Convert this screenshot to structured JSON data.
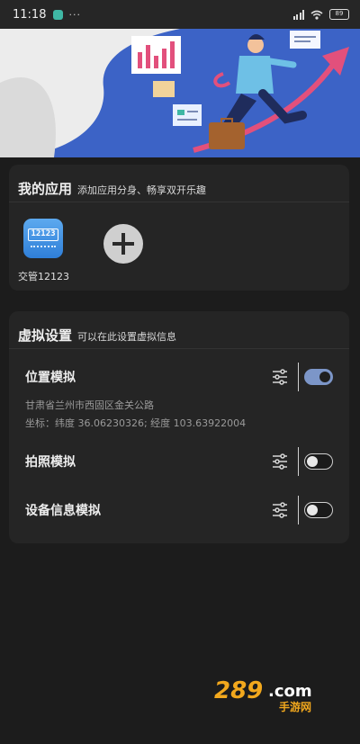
{
  "status_bar": {
    "time": "11:18",
    "dots": "···",
    "battery": "89"
  },
  "apps_card": {
    "title": "我的应用",
    "subtitle": "添加应用分身、畅享双开乐趣",
    "apps": [
      {
        "label": "交管12123",
        "icon_text": "12123",
        "icon": "traffic-app-icon"
      }
    ],
    "add_icon": "plus-icon"
  },
  "virtual_card": {
    "title": "虚拟设置",
    "subtitle": "可以在此设置虚拟信息",
    "rows": [
      {
        "label": "位置模拟",
        "enabled": true,
        "address": "甘肃省兰州市西固区金关公路",
        "coords": "坐标：纬度 36.06230326; 经度 103.63922004"
      },
      {
        "label": "拍照模拟",
        "enabled": false
      },
      {
        "label": "设备信息模拟",
        "enabled": false
      }
    ]
  },
  "watermark": {
    "text": "289.com",
    "sub": "手游网"
  },
  "colors": {
    "background": "#1c1c1c",
    "card": "#252525",
    "banner": "#3c63c6",
    "toggle_on": "#7c96c8",
    "watermark": "#f2a81d"
  }
}
